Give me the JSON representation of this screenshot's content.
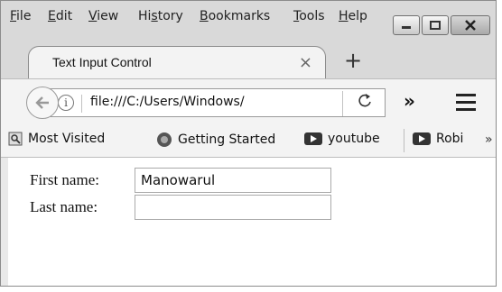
{
  "menubar": {
    "items": [
      {
        "first": "F",
        "rest": "ile"
      },
      {
        "first": "E",
        "rest": "dit"
      },
      {
        "first": "V",
        "rest": "iew"
      },
      {
        "pre": "Hi",
        "first": "s",
        "rest": "tory"
      },
      {
        "first": "B",
        "rest": "ookmarks"
      },
      {
        "first": "T",
        "rest": "ools"
      },
      {
        "first": "H",
        "rest": "elp"
      }
    ]
  },
  "tab": {
    "title": "Text Input Control",
    "close_glyph": "×"
  },
  "newtab": {
    "glyph": "+"
  },
  "navbar": {
    "url": "file:///C:/Users/Windows/",
    "info_glyph": "i",
    "reload_glyph": "C",
    "overflow_glyph": "»"
  },
  "bookmarks": {
    "items": [
      "Most Visited",
      "Getting Started",
      "youtube",
      "Robi"
    ],
    "more_glyph": "»"
  },
  "form": {
    "first_label": "First name:",
    "first_value": "Manowarul",
    "last_label": "Last name:",
    "last_value": ""
  },
  "icons": {
    "window_minimize": "minimize-icon",
    "window_maximize": "maximize-icon",
    "window_close": "close-icon",
    "back": "back-arrow-icon",
    "info": "info-icon",
    "reload": "reload-icon",
    "overflow": "chevron-double-right-icon",
    "menu": "hamburger-menu-icon",
    "most_visited": "most-visited-icon",
    "getting_started": "firefox-icon",
    "youtube": "youtube-icon",
    "robi": "youtube-icon"
  }
}
